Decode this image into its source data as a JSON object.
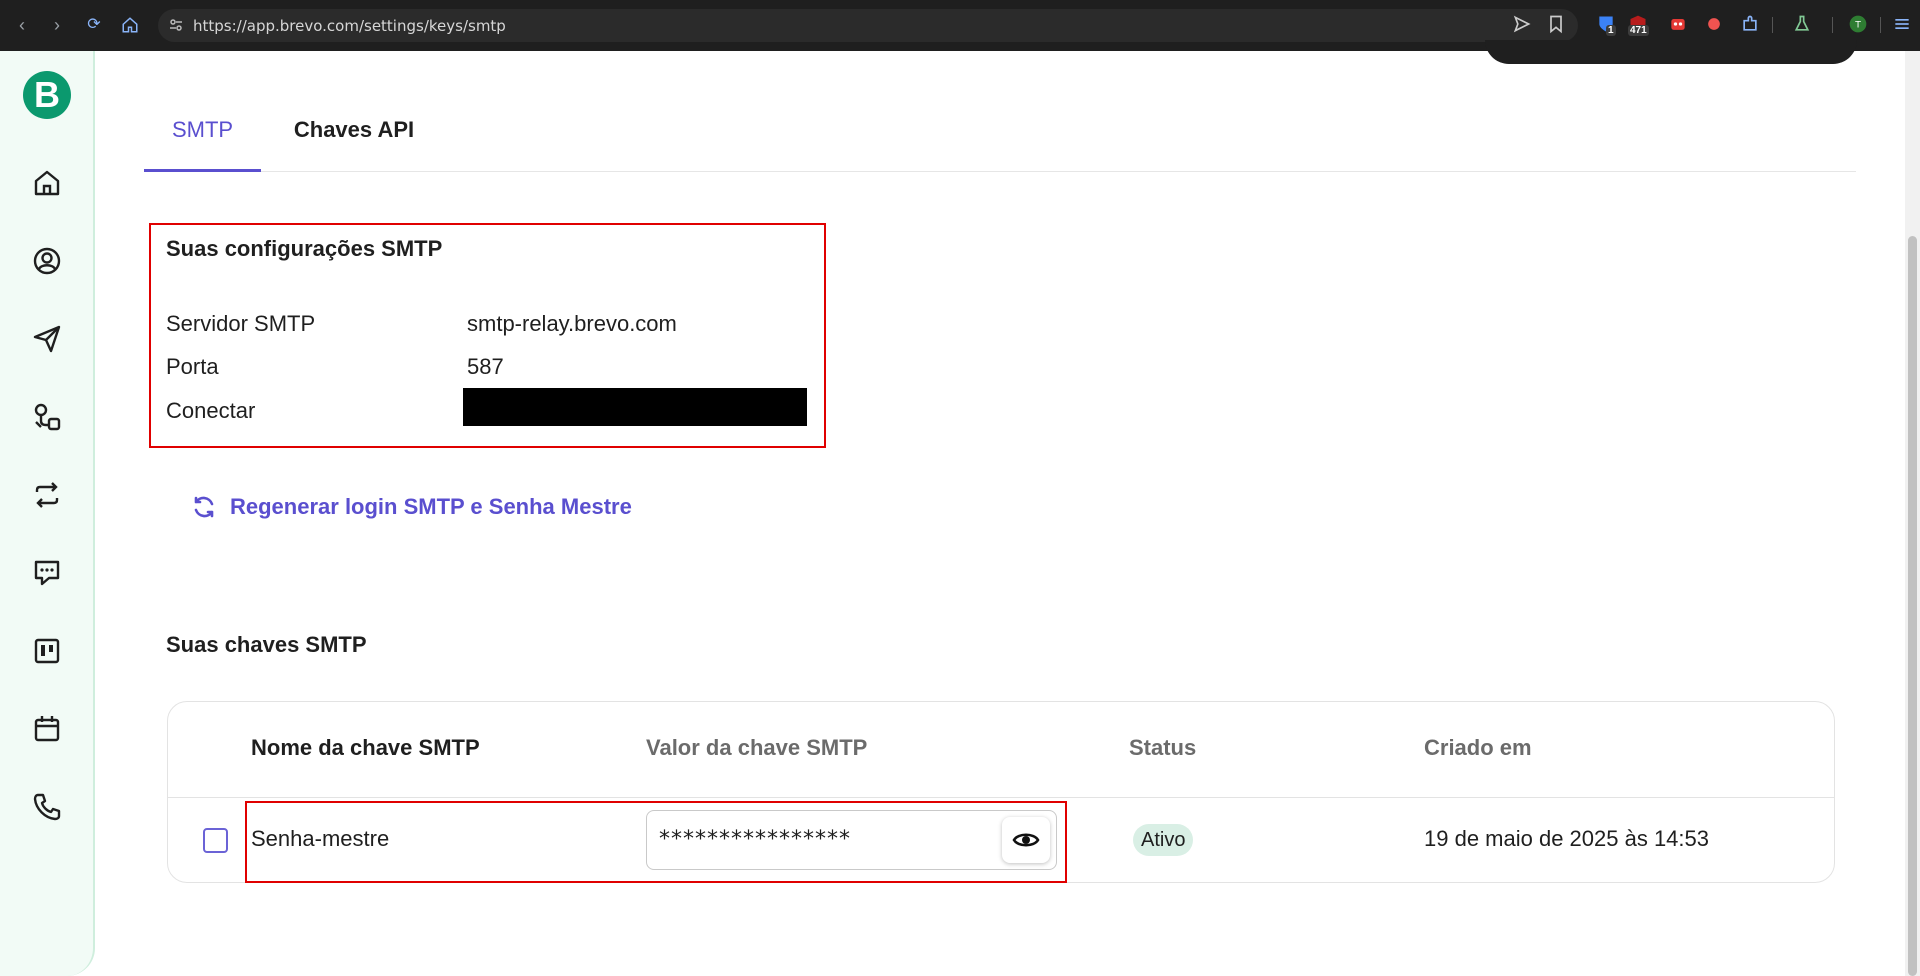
{
  "browser": {
    "url": "https://app.brevo.com/settings/keys/smtp",
    "extension_badges": [
      "1",
      "471"
    ]
  },
  "sidebar": {
    "logo_letter": "B",
    "items": [
      "home-icon",
      "contacts-icon",
      "campaigns-icon",
      "automations-icon",
      "transactional-icon",
      "conversations-icon",
      "deals-icon",
      "meetings-icon",
      "phone-icon"
    ]
  },
  "tabs": [
    {
      "label": "SMTP",
      "active": true
    },
    {
      "label": "Chaves API",
      "active": false
    }
  ],
  "smtp_settings": {
    "title": "Suas configurações SMTP",
    "rows": [
      {
        "label": "Servidor SMTP",
        "value": "smtp-relay.brevo.com"
      },
      {
        "label": "Porta",
        "value": "587"
      },
      {
        "label": "Conectar",
        "value": ""
      }
    ]
  },
  "regenerate_label": "Regenerar login SMTP e Senha Mestre",
  "smtp_keys": {
    "title": "Suas chaves SMTP",
    "columns": [
      "Nome da chave SMTP",
      "Valor da chave SMTP",
      "Status",
      "Criado em"
    ],
    "rows": [
      {
        "name": "Senha-mestre",
        "value": "****************",
        "status": "Ativo",
        "created": "19 de maio de 2025 às 14:53"
      }
    ]
  },
  "colors": {
    "accent": "#5a4fcf",
    "brand": "#0b996e",
    "highlight": "#e00000"
  }
}
